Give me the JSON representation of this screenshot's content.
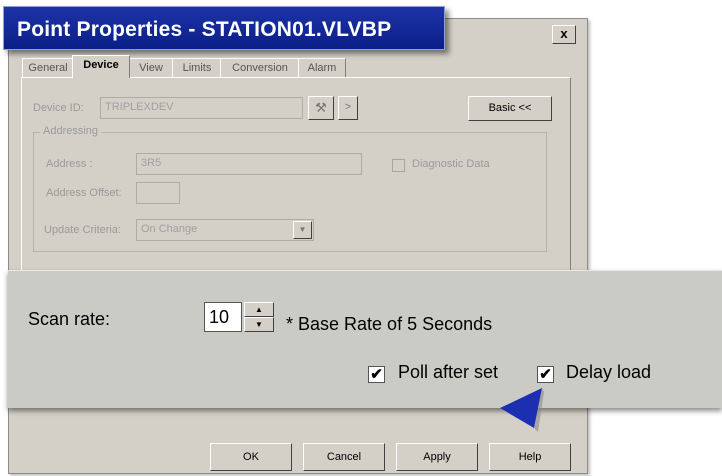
{
  "dialog": {
    "title": "Point Properties - STATION01.VLVBP",
    "close_label": "x"
  },
  "tabs": [
    {
      "label": "General"
    },
    {
      "label": "Device"
    },
    {
      "label": "View"
    },
    {
      "label": "Limits"
    },
    {
      "label": "Conversion"
    },
    {
      "label": "Alarm"
    }
  ],
  "device": {
    "device_id_label": "Device ID:",
    "device_id_value": "TRIPLEXDEV",
    "browse_label": ">",
    "basic_button_label": "Basic <<",
    "addressing_label": "Addressing",
    "address_label": "Address :",
    "address_value": "3R5",
    "address_offset_label": "Address Offset:",
    "address_offset_value": "",
    "diagnostic_label": "Diagnostic Data",
    "update_criteria_label": "Update Criteria:",
    "update_criteria_value": "On Change"
  },
  "zoom": {
    "scan_rate_label": "Scan rate:",
    "scan_rate_value": "10",
    "base_rate_text": "* Base Rate of 5 Seconds",
    "poll_after_set_label": "Poll after set",
    "poll_after_set_checked": true,
    "delay_load_label": "Delay load",
    "delay_load_checked": true
  },
  "buttons": {
    "ok": "OK",
    "cancel": "Cancel",
    "apply": "Apply",
    "help": "Help"
  },
  "colors": {
    "title_bar": "#0f23a0",
    "dialog_face": "#d4d0c8",
    "pointer": "#1b2fb0"
  },
  "icons": {
    "checkmark": "✔",
    "spin_up": "▲",
    "spin_down": "▼",
    "dropdown": "▼",
    "device_tool": "wrench-icon"
  }
}
